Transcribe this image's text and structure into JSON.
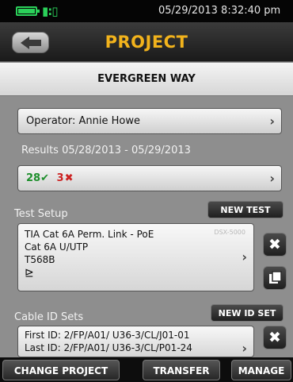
{
  "status": {
    "datetime": "05/29/2013 8:32:40 pm",
    "battery_icon": "battery-icon",
    "network_icon": "network-icon"
  },
  "header": {
    "title": "PROJECT",
    "back_icon": "back-arrow-icon"
  },
  "project_name": "EVERGREEN WAY",
  "operator": {
    "label": "Operator: Annie Howe"
  },
  "results": {
    "range_text": "Results 05/28/2013 - 05/29/2013",
    "pass_count": "28",
    "pass_mark": "✔",
    "fail_count": "3",
    "fail_mark": "✖"
  },
  "test_setup": {
    "section_label": "Test Setup",
    "new_button": "NEW TEST",
    "line1": "TIA Cat 6A Perm. Link - PoE",
    "line2": "Cat 6A U/UTP",
    "line3": "T568B",
    "serial": "DSX-5000",
    "connector_glyph": "⊵"
  },
  "cable_ids": {
    "section_label": "Cable ID Sets",
    "new_button": "NEW ID SET",
    "first_id": "First ID: 2/FP/A01/ U36-3/CL/J01-01",
    "last_id": "Last ID: 2/FP/A01/ U36-3/CL/P01-24"
  },
  "bottom": {
    "change_project": "CHANGE PROJECT",
    "transfer": "TRANSFER",
    "manage": "MANAGE"
  },
  "colors": {
    "title": "#f2b31c",
    "pass": "#1e8f2c",
    "fail": "#cc2222",
    "status_green": "#2bd15a"
  }
}
